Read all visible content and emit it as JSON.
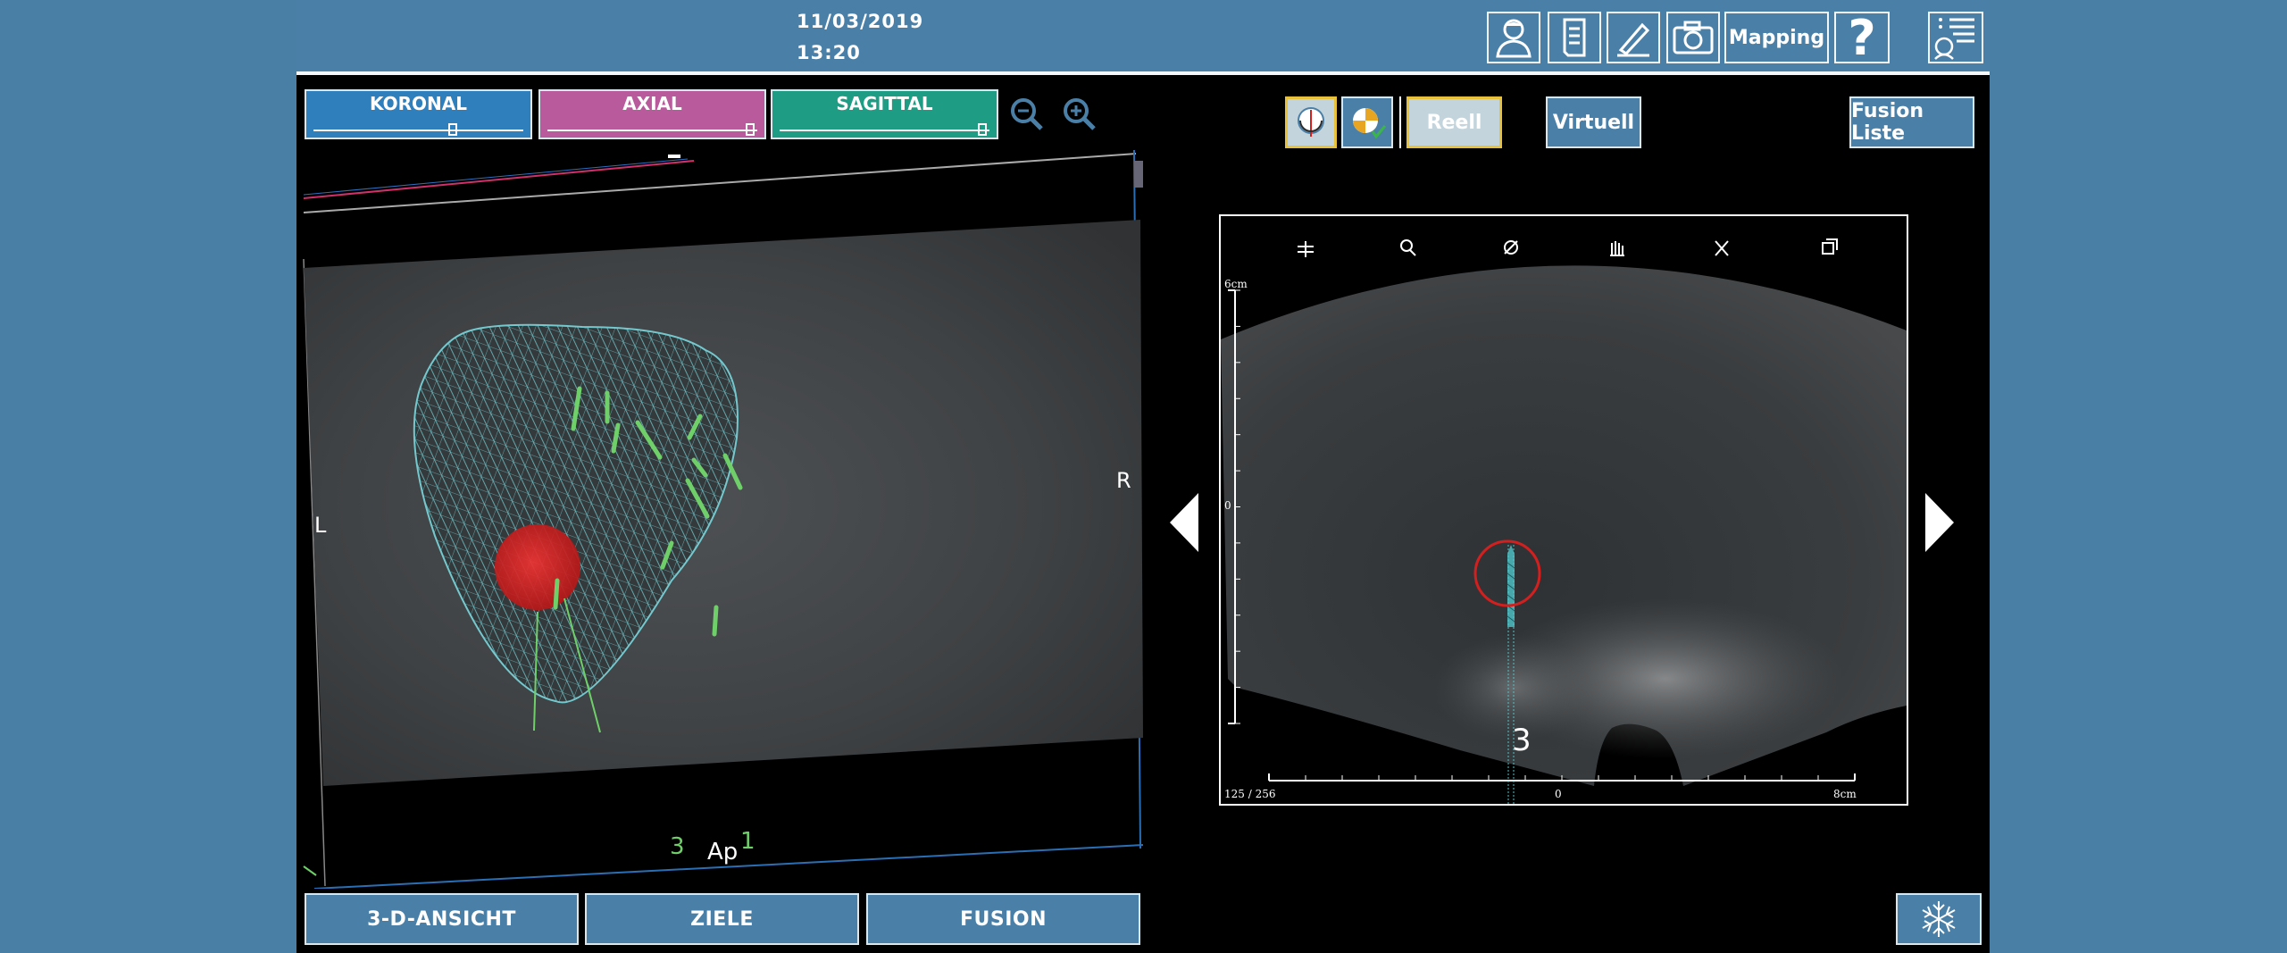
{
  "header": {
    "date": "11/03/2019",
    "time": "13:20",
    "toolbar": [
      {
        "name": "patient-icon"
      },
      {
        "name": "document-icon"
      },
      {
        "name": "pen-icon"
      },
      {
        "name": "camera-icon"
      },
      {
        "name": "mapping-button",
        "label": "Mapping"
      },
      {
        "name": "help-icon",
        "label": "?"
      },
      {
        "name": "patient-list-icon"
      }
    ],
    "mapping_label": "Mapping",
    "help_label": "?"
  },
  "view_tabs": [
    {
      "label": "KORONAL",
      "color": "#2f7fbd",
      "slider": 0.66
    },
    {
      "label": "AXIAL",
      "color": "#b85a9c",
      "slider": 0.97
    },
    {
      "label": "SAGITTAL",
      "color": "#1f9c84",
      "slider": 0.97
    }
  ],
  "view3d": {
    "orientation_left": "L",
    "orientation_right": "R",
    "needle_labels": [
      "3",
      "1"
    ],
    "apex_label": "Ap"
  },
  "bottom_buttons": {
    "view3d": "3-D-ANSICHT",
    "targets": "ZIELE",
    "fusion": "FUSION"
  },
  "right_toolbar": {
    "reell": "Reell",
    "virtuell": "Virtuell",
    "fusion_list": "Fusion Liste"
  },
  "ultrasound": {
    "depth_label": "6cm",
    "zero_left": "0",
    "zero_bottom": "0",
    "width_label": "8cm",
    "frame_counter": "125 / 256",
    "needle_number": "3",
    "tools": [
      "measure-icon",
      "zoom-icon",
      "brightness-icon",
      "pan-icon",
      "cross-tool-icon",
      "rotate-3d-icon"
    ]
  },
  "colors": {
    "accent": "#4a80a8",
    "target_red": "#d41f1f",
    "needle_green": "#6fd06a",
    "mesh_cyan": "#74c9cf"
  }
}
